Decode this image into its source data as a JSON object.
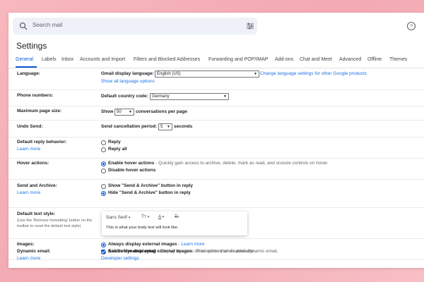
{
  "search": {
    "placeholder": "Search mail"
  },
  "page": {
    "title": "Settings"
  },
  "tabs": [
    "General",
    "Labels",
    "Inbox",
    "Accounts and Import",
    "Filters and Blocked Addresses",
    "Forwarding and POP/IMAP",
    "Add-ons",
    "Chat and Meet",
    "Advanced",
    "Offline",
    "Themes"
  ],
  "language": {
    "label": "Language:",
    "prefix": "Gmail display language:",
    "value": "English (US)",
    "change_link": "Change language settings for other Google products",
    "show_all": "Show all language options"
  },
  "phone": {
    "label": "Phone numbers:",
    "prefix": "Default country code:",
    "value": "Germany"
  },
  "page_size": {
    "label": "Maximum page size:",
    "show": "Show",
    "value": "50",
    "suffix": "conversations per page"
  },
  "undo": {
    "label": "Undo Send:",
    "prefix": "Send cancellation period:",
    "value": "5",
    "suffix": "seconds"
  },
  "reply": {
    "label": "Default reply behavior:",
    "learn": "Learn more",
    "opt1": "Reply",
    "opt2": "Reply all"
  },
  "hover": {
    "label": "Hover actions:",
    "opt1": "Enable hover actions",
    "opt1_desc": " - Quickly gain access to archive, delete, mark as read, and snooze controls on hover.",
    "opt2": "Disable hover actions"
  },
  "send_archive": {
    "label": "Send and Archive:",
    "learn": "Learn more",
    "opt1": "Show \"Send & Archive\" button in reply",
    "opt2": "Hide \"Send & Archive\" button in reply"
  },
  "text_style": {
    "label": "Default text style:",
    "note": "(Use the 'Remove formatting' button on the toolbar to reset the default text style)",
    "font": "Sans Serif",
    "preview": "This is what your body text will look like."
  },
  "images": {
    "label": "Images:",
    "opt1": "Always display external images",
    "opt1_sep": " - ",
    "opt1_link": "Learn more",
    "opt2": "Ask before displaying external images",
    "opt2_desc": " - This option also disables dynamic email."
  },
  "dynamic": {
    "label": "Dynamic email:",
    "learn": "Learn more",
    "opt": "Enable dynamic email",
    "desc": " - Display dynamic email content when available.",
    "dev": "Developer settings"
  },
  "colors": {
    "accent": "#0b57d0",
    "link": "#1a73e8"
  }
}
